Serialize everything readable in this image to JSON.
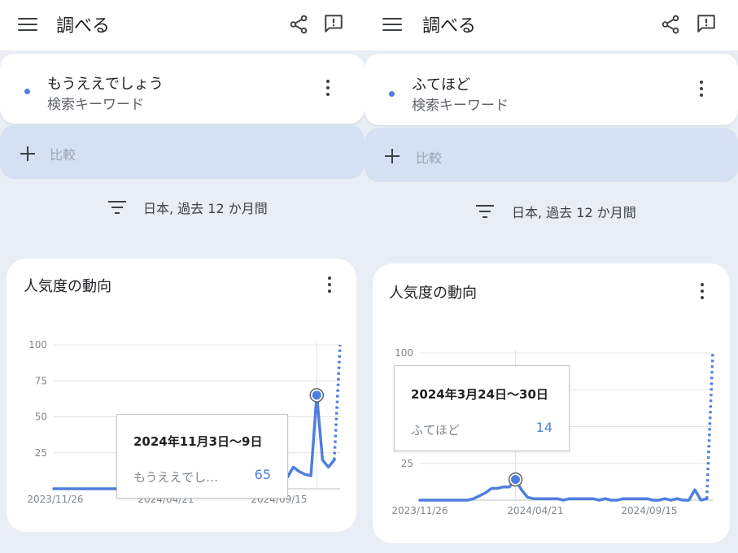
{
  "colors": {
    "accent": "#4f7fde",
    "panel_bg": "#e9eef6",
    "compare_bg": "#d5e0f2"
  },
  "left": {
    "app_title": "調べる",
    "icons": [
      "menu-icon",
      "share-icon",
      "feedback-icon",
      "more-vert-icon",
      "add-icon",
      "filter-icon"
    ],
    "search_term": "もうええでしょう",
    "search_sub": "検索キーワード",
    "compare_label": "比較",
    "filter_text": "日本, 過去 12 か月間",
    "chart_title": "人気度の動向",
    "tooltip": {
      "date": "2024年11月3日〜9日",
      "term": "もうええでし…",
      "value": "65"
    },
    "chart_data": {
      "type": "line",
      "series": [
        {
          "name": "もうええでしょう",
          "values": [
            0,
            0,
            0,
            0,
            0,
            0,
            0,
            0,
            0,
            0,
            0,
            0,
            0,
            0,
            0,
            0,
            0,
            0,
            0,
            0,
            0,
            0,
            0,
            0,
            0,
            0,
            0,
            0,
            0,
            0,
            1,
            2,
            3,
            3,
            4,
            5,
            7,
            8,
            10,
            9,
            8,
            15,
            12,
            10,
            9,
            65,
            20,
            15,
            20,
            100
          ]
        }
      ],
      "x_tick_labels": [
        "2023/11/26",
        "2024/04/21",
        "2024/09/15"
      ],
      "y_ticks": [
        25,
        50,
        75,
        100
      ],
      "ylim": [
        0,
        100
      ],
      "highlight": {
        "label": "2024年11月3日〜9日",
        "value": 65
      },
      "grid": true,
      "last_segment_dotted": true
    }
  },
  "right": {
    "app_title": "調べる",
    "search_term": "ふてほど",
    "search_sub": "検索キーワード",
    "compare_label": "比較",
    "filter_text": "日本, 過去 12 か月間",
    "chart_title": "人気度の動向",
    "tooltip": {
      "date": "2024年3月24日〜30日",
      "term": "ふてほど",
      "value": "14"
    },
    "chart_data": {
      "type": "line",
      "series": [
        {
          "name": "ふてほど",
          "values": [
            0,
            0,
            0,
            0,
            0,
            0,
            0,
            0,
            0,
            1,
            3,
            5,
            8,
            8,
            9,
            9,
            14,
            7,
            2,
            1,
            1,
            1,
            1,
            1,
            0,
            1,
            1,
            1,
            1,
            1,
            0,
            1,
            0,
            0,
            1,
            1,
            1,
            1,
            1,
            0,
            0,
            1,
            0,
            1,
            0,
            0,
            7,
            0,
            1,
            100
          ]
        }
      ],
      "x_tick_labels": [
        "2023/11/26",
        "2024/04/21",
        "2024/09/15"
      ],
      "y_ticks": [
        25,
        50,
        75,
        100
      ],
      "ylim": [
        0,
        100
      ],
      "highlight": {
        "label": "2024年3月24日〜30日",
        "value": 14
      },
      "grid": true,
      "last_segment_dotted": true
    }
  }
}
